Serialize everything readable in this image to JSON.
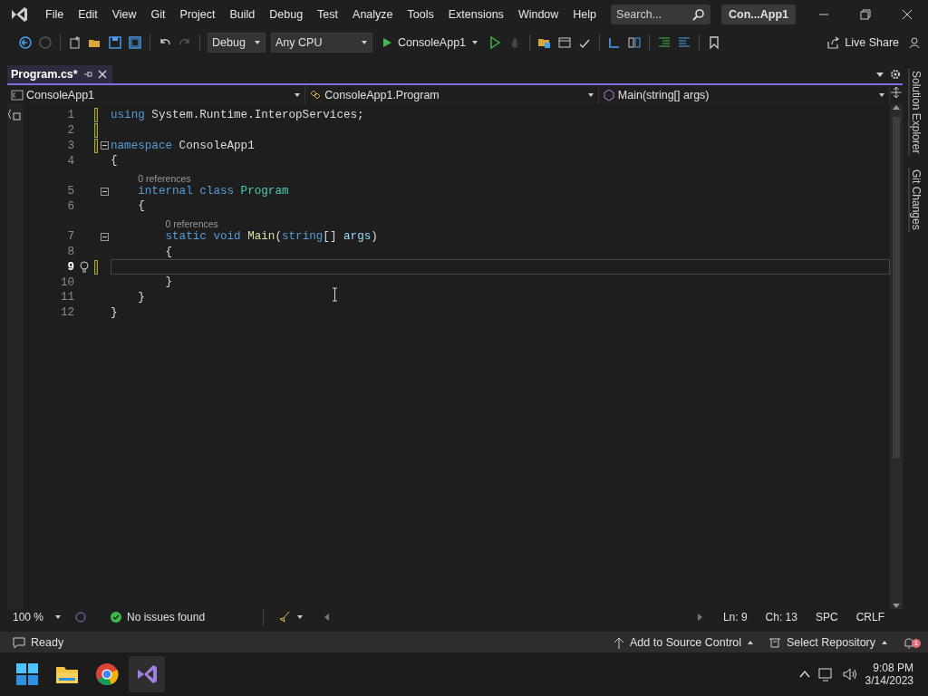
{
  "title_bar": {
    "menu": [
      "File",
      "Edit",
      "View",
      "Git",
      "Project",
      "Build",
      "Debug",
      "Test",
      "Analyze",
      "Tools",
      "Extensions",
      "Window",
      "Help"
    ],
    "search": {
      "placeholder": "Search..."
    },
    "solution_name": "Con...App1"
  },
  "toolbar": {
    "configuration": "Debug",
    "platform": "Any CPU",
    "start_target": "ConsoleApp1",
    "live_share": "Live Share"
  },
  "tabs": [
    {
      "label": "Program.cs*",
      "selected": true
    }
  ],
  "navigation_bar": [
    "ConsoleApp1",
    "ConsoleApp1.Program",
    "Main(string[] args)"
  ],
  "editor": {
    "lines": [
      {
        "number": "1",
        "changed": true,
        "fold": false,
        "current": false,
        "tokens": [
          {
            "text": "using",
            "kind": "keyword"
          },
          {
            "text": " System.Runtime.InteropServices;",
            "kind": "plain"
          }
        ]
      },
      {
        "number": "2",
        "changed": true,
        "fold": false,
        "current": false
      },
      {
        "number": "3",
        "changed": true,
        "fold": true,
        "current": false,
        "tokens": [
          {
            "text": "namespace",
            "kind": "keyword"
          },
          {
            "text": " ConsoleApp1",
            "kind": "plain"
          }
        ]
      },
      {
        "number": "4",
        "changed": false,
        "fold": false,
        "current": false,
        "tokens": [
          {
            "text": "{",
            "kind": "plain"
          }
        ],
        "children": [
          {
            "number": "5",
            "changed": false,
            "fold": true,
            "current": false,
            "annotation": "0 references",
            "tokens": [
              {
                "text": "internal",
                "kind": "keyword"
              },
              {
                "text": " class",
                "kind": "keyword"
              },
              {
                "text": " Program",
                "kind": "type"
              }
            ]
          },
          {
            "number": "6",
            "changed": false,
            "fold": false,
            "current": false,
            "tokens": [
              {
                "text": "{",
                "kind": "plain"
              }
            ],
            "children": [
              {
                "number": "7",
                "changed": false,
                "fold": true,
                "current": false,
                "annotation": "0 references",
                "tokens": [
                  {
                    "text": "static",
                    "kind": "keyword"
                  },
                  {
                    "text": " void",
                    "kind": "keyword"
                  },
                  {
                    "text": " Main",
                    "kind": "method"
                  },
                  {
                    "text": "(",
                    "kind": "plain"
                  },
                  {
                    "text": "string",
                    "kind": "keyword"
                  },
                  {
                    "text": "[] ",
                    "kind": "plain"
                  },
                  {
                    "text": "args",
                    "kind": "param"
                  },
                  {
                    "text": ")",
                    "kind": "plain"
                  }
                ]
              },
              {
                "number": "8",
                "changed": false,
                "fold": false,
                "current": false,
                "tokens": [
                  {
                    "text": "{",
                    "kind": "plain"
                  }
                ],
                "children": [
                  {
                    "number": "9",
                    "changed": true,
                    "fold": false,
                    "current": true
                  }
                ]
              },
              {
                "number": "10",
                "changed": false,
                "fold": false,
                "current": false,
                "tokens": [
                  {
                    "text": "}",
                    "kind": "plain"
                  }
                ]
              }
            ]
          },
          {
            "number": "11",
            "changed": false,
            "fold": false,
            "current": false,
            "tokens": [
              {
                "text": "}",
                "kind": "plain"
              }
            ]
          }
        ]
      },
      {
        "number": "12",
        "changed": false,
        "fold": false,
        "current": false,
        "tokens": [
          {
            "text": "}",
            "kind": "plain"
          }
        ]
      }
    ]
  },
  "editor_footer": {
    "zoom": "100 %",
    "issues": "No issues found",
    "line": "Ln: 9",
    "column": "Ch: 13",
    "whitespace": "SPC",
    "line_endings": "CRLF"
  },
  "side_tabs": [
    "Solution Explorer",
    "Git Changes"
  ],
  "status_bar": {
    "state": "Ready",
    "source_control": "Add to Source Control",
    "repository": "Select Repository",
    "notifications": "1"
  },
  "taskbar": {
    "time": "9:08 PM",
    "date": "3/14/2023"
  }
}
